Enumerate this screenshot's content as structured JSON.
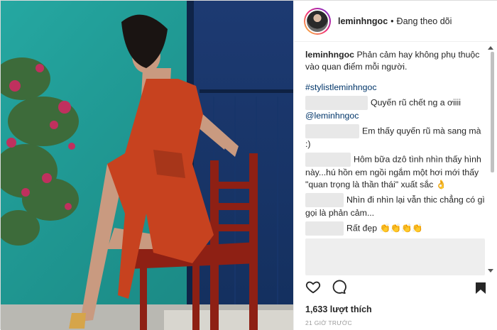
{
  "post": {
    "username": "leminhngoc",
    "follow_status": "Đang theo dõi",
    "separator": "•"
  },
  "comments": {
    "caption": "Phản cảm hay không phụ thuộc vào quan điểm mỗi người.",
    "hashtag": "#stylistleminhngoc",
    "c1": "Quyến rũ chết ng a ơiiii",
    "c1_mention": "@leminhngoc",
    "c2": "Em thấy quyến rũ mà sang mà :)",
    "c3": "Hôm bữa dzô tình nhìn thấy hình này...hú hồn em ngồi ngắm một hơi mới thấy \"quan trọng là thần thái\" xuất sắc 👌",
    "c4": "Nhìn đi nhìn lại vẫn thic chẳng có gì gọi là phản cảm...",
    "c5": "Rất đẹp 👏👏👏👏"
  },
  "footer": {
    "likes": "1,633 lượt thích",
    "time": "21 GIỜ TRƯỚC"
  },
  "icons": {
    "like": "heart-icon",
    "comment": "comment-icon",
    "save": "bookmark-icon"
  },
  "colors": {
    "wall": "#1f9a95",
    "door": "#1e3f7a",
    "dress": "#c7421f",
    "chair": "#8e2014"
  }
}
